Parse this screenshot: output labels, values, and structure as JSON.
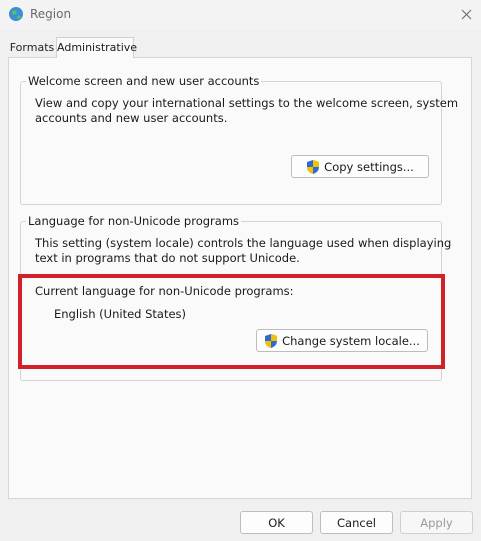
{
  "window": {
    "title": "Region",
    "close_symbol": "✕"
  },
  "tabs": [
    {
      "label": "Formats",
      "active": false
    },
    {
      "label": "Administrative",
      "active": true
    }
  ],
  "welcome_group": {
    "title": "Welcome screen and new user accounts",
    "description_line1": "View and copy your international settings to the welcome screen, system",
    "description_line2": "accounts and new user accounts.",
    "copy_button": "Copy settings..."
  },
  "language_group": {
    "title": "Language for non-Unicode programs",
    "description_line1": "This setting (system locale) controls the language used when displaying",
    "description_line2": "text in programs that do not support Unicode.",
    "current_label": "Current language for non-Unicode programs:",
    "current_value": "English (United States)",
    "change_button": "Change system locale..."
  },
  "footer": {
    "ok": "OK",
    "cancel": "Cancel",
    "apply": "Apply"
  },
  "colors": {
    "highlight": "#d1222b",
    "shield_blue": "#2d6ad6",
    "shield_yellow": "#f2c200"
  }
}
